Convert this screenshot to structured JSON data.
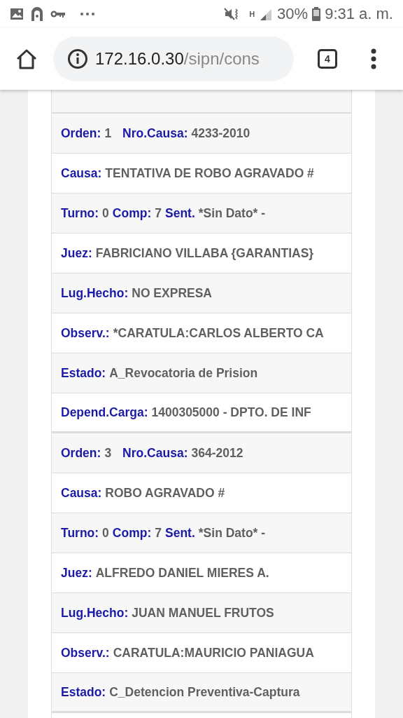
{
  "status_bar": {
    "battery": "30%",
    "time": "9:31 a. m.",
    "network": "H"
  },
  "browser": {
    "url_host": "172.16.0.30",
    "url_path": "/sipn/cons",
    "tab_count": "4"
  },
  "records": [
    {
      "rows": [
        [
          {
            "label": "Orden:",
            "value": "1"
          },
          {
            "label": "Nro.Causa:",
            "value": "4233-2010"
          }
        ],
        [
          {
            "label": "Causa:",
            "value": "TENTATIVA DE ROBO AGRAVADO #"
          }
        ],
        [
          {
            "label": "Turno:",
            "value": "0"
          },
          {
            "label": "Comp:",
            "value": "7"
          },
          {
            "label": "Sent.",
            "value": "*Sin Dato* -"
          }
        ],
        [
          {
            "label": "Juez:",
            "value": "FABRICIANO VILLABA {GARANTIAS}"
          }
        ],
        [
          {
            "label": "Lug.Hecho:",
            "value": "NO EXPRESA"
          }
        ],
        [
          {
            "label": "Observ.:",
            "value": "*CARATULA:CARLOS ALBERTO CA"
          }
        ],
        [
          {
            "label": "Estado:",
            "value": "A_Revocatoria de Prision"
          }
        ],
        [
          {
            "label": "Depend.Carga:",
            "value": "1400305000 - DPTO. DE INF"
          }
        ]
      ]
    },
    {
      "rows": [
        [
          {
            "label": "Orden:",
            "value": "3"
          },
          {
            "label": "Nro.Causa:",
            "value": "364-2012"
          }
        ],
        [
          {
            "label": "Causa:",
            "value": "ROBO AGRAVADO #"
          }
        ],
        [
          {
            "label": "Turno:",
            "value": "0"
          },
          {
            "label": "Comp:",
            "value": "7"
          },
          {
            "label": "Sent.",
            "value": "*Sin Dato* -"
          }
        ],
        [
          {
            "label": "Juez:",
            "value": "ALFREDO DANIEL MIERES A."
          }
        ],
        [
          {
            "label": "Lug.Hecho:",
            "value": "JUAN MANUEL FRUTOS"
          }
        ],
        [
          {
            "label": "Observ.:",
            "value": "CARATULA:MAURICIO PANIAGUA"
          }
        ],
        [
          {
            "label": "Estado:",
            "value": "C_Detencion Preventiva-Captura"
          }
        ]
      ]
    }
  ]
}
